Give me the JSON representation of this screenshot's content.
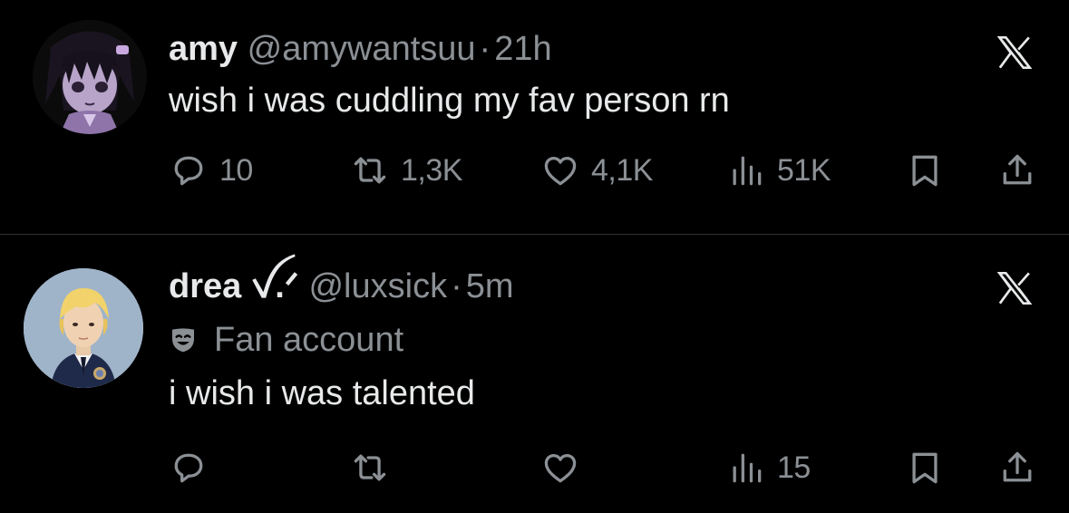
{
  "tweets": [
    {
      "display_name": "amy",
      "handle": "@amywantsuu",
      "separator": "·",
      "time": "21h",
      "text": "wish i was cuddling my fav person rn",
      "badge": "",
      "stats": {
        "replies": "10",
        "reposts": "1,3K",
        "likes": "4,1K",
        "views": "51K"
      },
      "avatar": "anime-girl-purple-avatar"
    },
    {
      "display_name": "drea ꪜ.ᐟ",
      "handle": "@luxsick",
      "separator": "·",
      "time": "5m",
      "text": "i wish i was talented",
      "badge": "Fan account",
      "stats": {
        "replies": "",
        "reposts": "",
        "likes": "",
        "views": "15"
      },
      "avatar": "blond-student-avatar"
    }
  ],
  "icons": [
    "x-logo-icon",
    "reply-icon",
    "repost-icon",
    "like-icon",
    "views-icon",
    "bookmark-icon",
    "share-icon",
    "theater-mask-icon"
  ],
  "colors": {
    "background": "#000000",
    "text": "#e7e9ea",
    "muted": "#8b9095",
    "divider": "#2f3336"
  }
}
